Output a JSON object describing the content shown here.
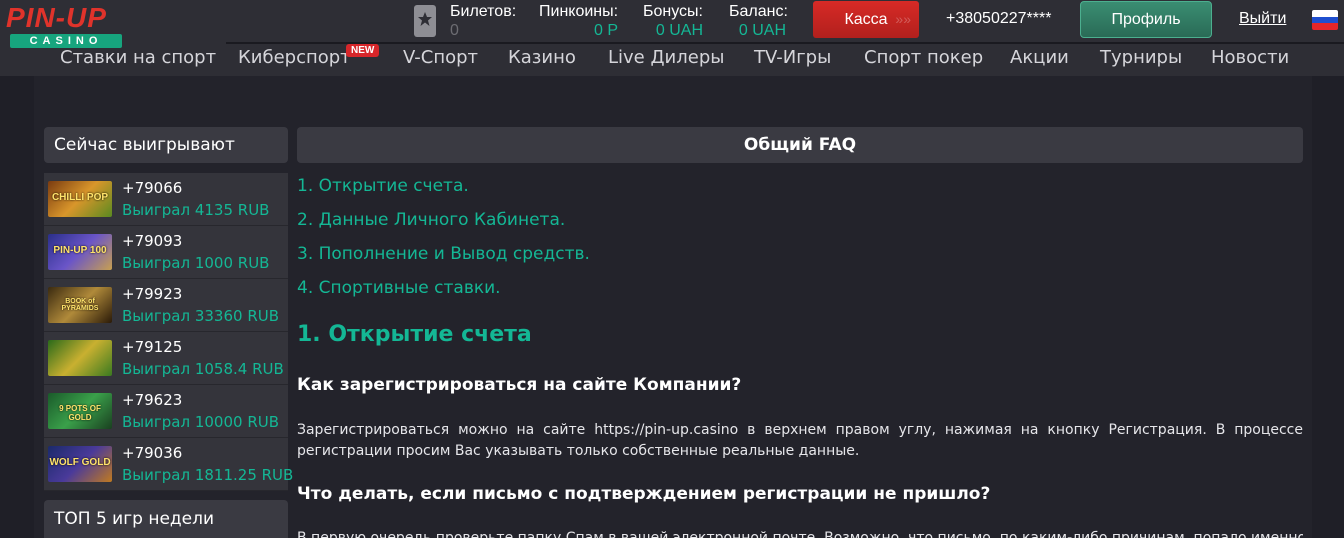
{
  "header": {
    "logo_text": "PIN-UP",
    "logo_sub": "CASINO",
    "stats": [
      {
        "label": "Билетов:",
        "value": "0"
      },
      {
        "label": "Пинкоины:",
        "value": "0 Р"
      },
      {
        "label": "Бонусы:",
        "value": "0 UAH"
      },
      {
        "label": "Баланс:",
        "value": "0 UAH"
      }
    ],
    "kassa_label": "Касса",
    "phone": "+38050227****",
    "profile_label": "Профиль",
    "logout_label": "Выйти",
    "flag_colors": [
      "#ffffff",
      "#1f4fcf",
      "#e4262a"
    ],
    "accent_color": "#14b795",
    "kassa_color": "#d72a26"
  },
  "nav": {
    "items": [
      {
        "label": "Ставки на спорт"
      },
      {
        "label": "Киберспорт"
      },
      {
        "label": "V-Спорт"
      },
      {
        "label": "Казино"
      },
      {
        "label": "Live Дилеры"
      },
      {
        "label": "TV-Игры"
      },
      {
        "label": "Спорт покер"
      },
      {
        "label": "Акции"
      },
      {
        "label": "Турниры"
      },
      {
        "label": "Новости"
      }
    ],
    "new_badge": "NEW"
  },
  "sidebar": {
    "title": "Сейчас выигрывают",
    "winners": [
      {
        "phone": "+79066",
        "won": "Выиграл 4135 RUB",
        "game": "CHILLI POP"
      },
      {
        "phone": "+79093",
        "won": "Выиграл 1000 RUB",
        "game": "PIN-UP 100"
      },
      {
        "phone": "+79923",
        "won": "Выиграл 33360 RUB",
        "game": "BOOK of PYRAMIDS"
      },
      {
        "phone": "+79125",
        "won": "Выиграл 1058.4 RUB",
        "game": ""
      },
      {
        "phone": "+79623",
        "won": "Выиграл 10000 RUB",
        "game": "9 POTS OF GOLD"
      },
      {
        "phone": "+79036",
        "won": "Выиграл 1811.25 RUB",
        "game": "WOLF GOLD"
      }
    ],
    "top5_title": "ТОП 5 игр недели"
  },
  "faq": {
    "title": "Общий FAQ",
    "links": [
      "1. Открытие счета.",
      "2. Данные Личного Кабинета.",
      "3. Пополнение и Вывод средств.",
      "4. Спортивные ставки."
    ],
    "section_title": "1. Открытие счета",
    "q1": "Как зарегистрироваться на сайте Компании?",
    "a1": "Зарегистрироваться можно на сайте https://pin-up.casino в верхнем правом углу, нажимая на кнопку Регистрация. В процессе регистрации просим Вас указывать только собственные реальные данные.",
    "q2": "Что делать, если письмо с подтверждением регистрации не пришло?",
    "a2": "В первую очередь проверьте папку Спам в вашей электронной почте. Возможно, что письмо, по каким-либо причинам, попало именно"
  }
}
